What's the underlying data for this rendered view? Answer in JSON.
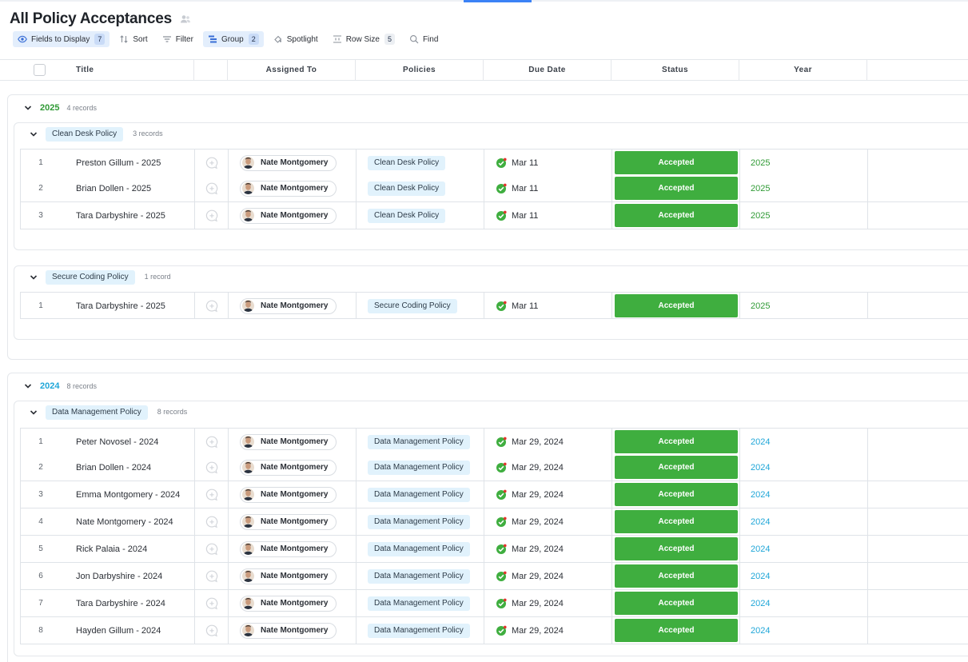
{
  "page": {
    "title": "All Policy Acceptances"
  },
  "toolbar": {
    "fields": {
      "label": "Fields to Display",
      "count": "7"
    },
    "sort": {
      "label": "Sort"
    },
    "filter": {
      "label": "Filter"
    },
    "group": {
      "label": "Group",
      "count": "2"
    },
    "spotlight": {
      "label": "Spotlight"
    },
    "row_size": {
      "label": "Row Size",
      "count": "5"
    },
    "find": {
      "label": "Find"
    }
  },
  "columns": {
    "title": "Title",
    "assigned_to": "Assigned To",
    "policies": "Policies",
    "due_date": "Due Date",
    "status": "Status",
    "year": "Year"
  },
  "colors": {
    "accent": "#3b82f6",
    "accepted": "#3fae3f",
    "year_2025": "#2f9a35",
    "year_2024": "#1fa6d8"
  },
  "groups": [
    {
      "year": "2025",
      "count_label": "4 records",
      "color": "#2f9a35",
      "subgroups": [
        {
          "policy": "Clean Desk Policy",
          "count_label": "3 records",
          "rows": [
            {
              "num": "1",
              "title": "Preston Gillum - 2025",
              "assignee": "Nate Montgomery",
              "policy": "Clean Desk Policy",
              "due": "Mar 11",
              "status": "Accepted",
              "year": "2025"
            },
            {
              "num": "2",
              "title": "Brian Dollen - 2025",
              "assignee": "Nate Montgomery",
              "policy": "Clean Desk Policy",
              "due": "Mar 11",
              "status": "Accepted",
              "year": "2025"
            },
            {
              "num": "3",
              "title": "Tara Darbyshire - 2025",
              "assignee": "Nate Montgomery",
              "policy": "Clean Desk Policy",
              "due": "Mar 11",
              "status": "Accepted",
              "year": "2025"
            }
          ]
        },
        {
          "policy": "Secure Coding Policy",
          "count_label": "1 record",
          "rows": [
            {
              "num": "1",
              "title": "Tara Darbyshire - 2025",
              "assignee": "Nate Montgomery",
              "policy": "Secure Coding Policy",
              "due": "Mar 11",
              "status": "Accepted",
              "year": "2025"
            }
          ]
        }
      ]
    },
    {
      "year": "2024",
      "count_label": "8 records",
      "color": "#1fa6d8",
      "subgroups": [
        {
          "policy": "Data Management Policy",
          "count_label": "8 records",
          "rows": [
            {
              "num": "1",
              "title": "Peter Novosel - 2024",
              "assignee": "Nate Montgomery",
              "policy": "Data Management Policy",
              "due": "Mar 29, 2024",
              "status": "Accepted",
              "year": "2024"
            },
            {
              "num": "2",
              "title": "Brian Dollen - 2024",
              "assignee": "Nate Montgomery",
              "policy": "Data Management Policy",
              "due": "Mar 29, 2024",
              "status": "Accepted",
              "year": "2024"
            },
            {
              "num": "3",
              "title": "Emma Montgomery - 2024",
              "assignee": "Nate Montgomery",
              "policy": "Data Management Policy",
              "due": "Mar 29, 2024",
              "status": "Accepted",
              "year": "2024"
            },
            {
              "num": "4",
              "title": "Nate Montgomery - 2024",
              "assignee": "Nate Montgomery",
              "policy": "Data Management Policy",
              "due": "Mar 29, 2024",
              "status": "Accepted",
              "year": "2024"
            },
            {
              "num": "5",
              "title": "Rick Palaia - 2024",
              "assignee": "Nate Montgomery",
              "policy": "Data Management Policy",
              "due": "Mar 29, 2024",
              "status": "Accepted",
              "year": "2024"
            },
            {
              "num": "6",
              "title": "Jon Darbyshire - 2024",
              "assignee": "Nate Montgomery",
              "policy": "Data Management Policy",
              "due": "Mar 29, 2024",
              "status": "Accepted",
              "year": "2024"
            },
            {
              "num": "7",
              "title": "Tara Darbyshire - 2024",
              "assignee": "Nate Montgomery",
              "policy": "Data Management Policy",
              "due": "Mar 29, 2024",
              "status": "Accepted",
              "year": "2024"
            },
            {
              "num": "8",
              "title": "Hayden Gillum - 2024",
              "assignee": "Nate Montgomery",
              "policy": "Data Management Policy",
              "due": "Mar 29, 2024",
              "status": "Accepted",
              "year": "2024"
            }
          ]
        }
      ]
    }
  ]
}
